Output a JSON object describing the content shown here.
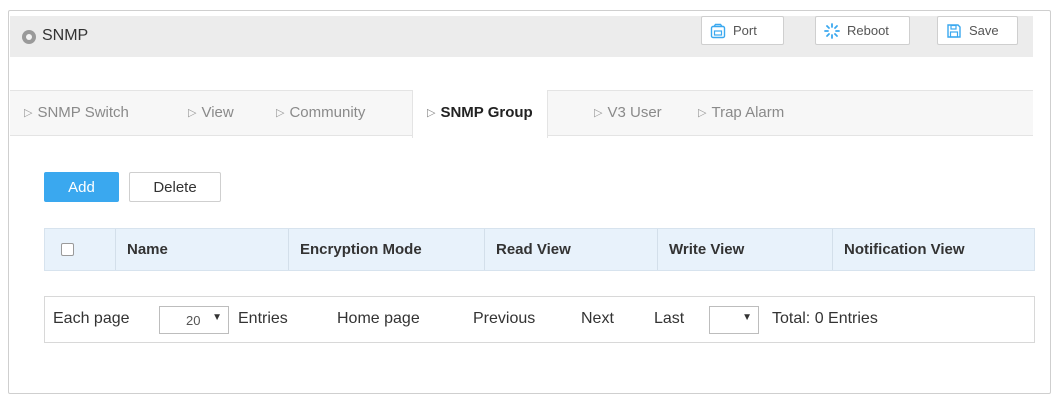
{
  "header": {
    "title": "SNMP",
    "buttons": {
      "port": "Port",
      "reboot": "Reboot",
      "save": "Save"
    }
  },
  "tabs": [
    {
      "label": "SNMP Switch"
    },
    {
      "label": "View"
    },
    {
      "label": "Community"
    },
    {
      "label": "SNMP Group"
    },
    {
      "label": "V3 User"
    },
    {
      "label": "Trap Alarm"
    }
  ],
  "active_tab": "SNMP Group",
  "actions": {
    "add": "Add",
    "delete": "Delete"
  },
  "table": {
    "columns": [
      "Name",
      "Encryption Mode",
      "Read View",
      "Write View",
      "Notification View"
    ],
    "rows": []
  },
  "pager": {
    "each_page_label": "Each page",
    "page_size": "20",
    "entries_label": "Entries",
    "home": "Home page",
    "previous": "Previous",
    "next": "Next",
    "last": "Last",
    "page_select": "",
    "total": "Total: 0 Entries"
  },
  "colors": {
    "accent": "#3aa8ef",
    "header_bg": "#ececec",
    "table_header_bg": "#e8f2fb"
  }
}
